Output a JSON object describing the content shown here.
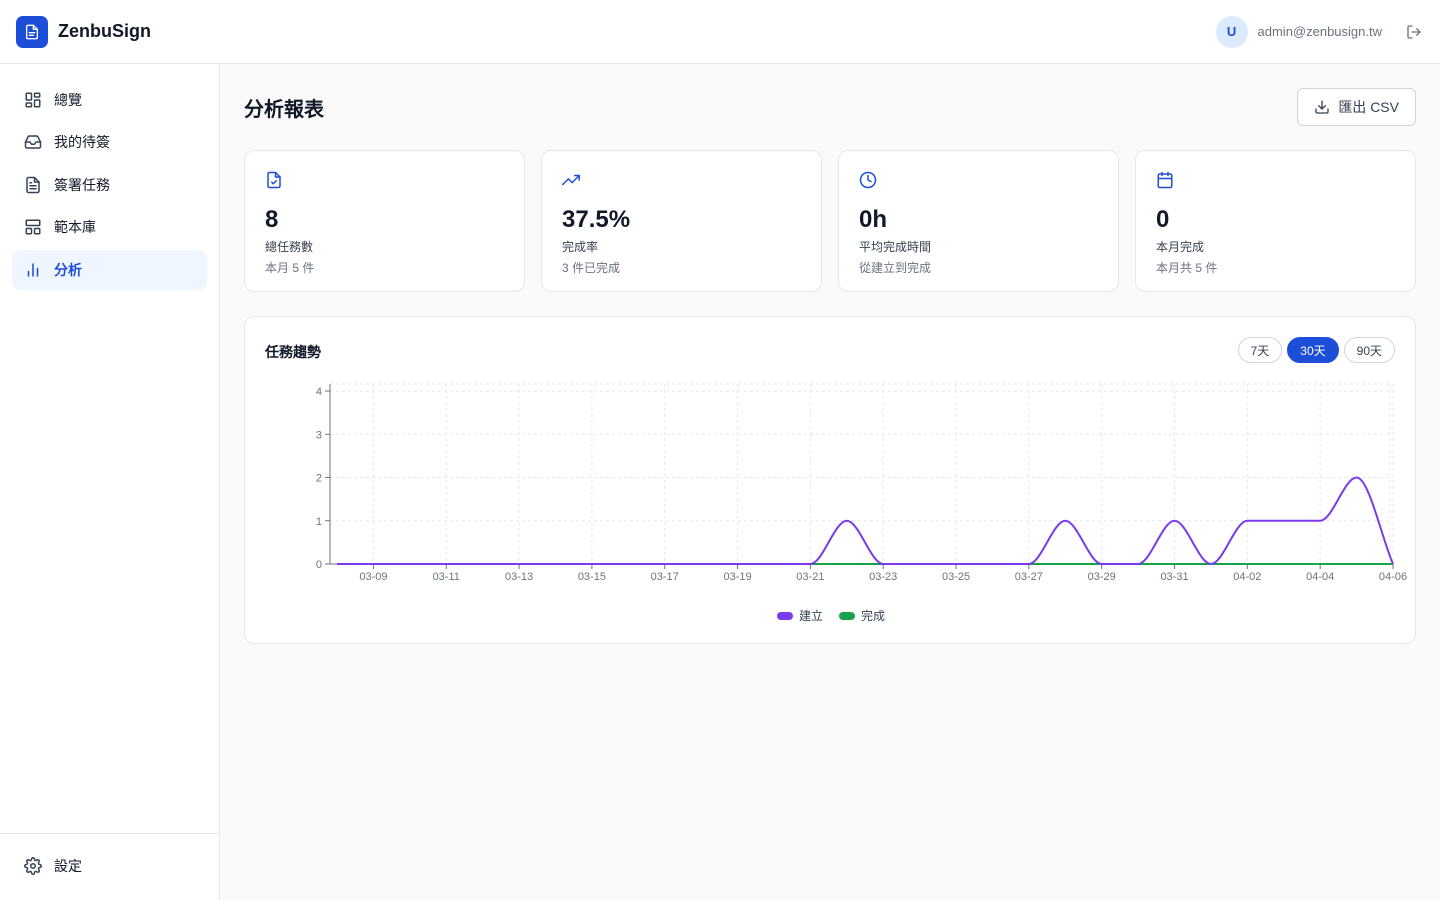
{
  "app": {
    "name": "ZenbuSign"
  },
  "user": {
    "initial": "U",
    "email": "admin@zenbusign.tw"
  },
  "sidebar": {
    "items": [
      {
        "label": "總覽",
        "icon": "grid-icon"
      },
      {
        "label": "我的待簽",
        "icon": "inbox-icon"
      },
      {
        "label": "簽署任務",
        "icon": "document-icon"
      },
      {
        "label": "範本庫",
        "icon": "template-icon"
      },
      {
        "label": "分析",
        "icon": "bar-chart-icon",
        "active": true
      }
    ],
    "settings_label": "設定"
  },
  "page": {
    "title": "分析報表",
    "export_label": "匯出 CSV"
  },
  "stats": [
    {
      "icon": "file-check-icon",
      "value": "8",
      "label": "總任務數",
      "sub": "本月 5 件"
    },
    {
      "icon": "trending-up-icon",
      "value": "37.5%",
      "label": "完成率",
      "sub": "3 件已完成"
    },
    {
      "icon": "clock-icon",
      "value": "0h",
      "label": "平均完成時間",
      "sub": "從建立到完成"
    },
    {
      "icon": "calendar-icon",
      "value": "0",
      "label": "本月完成",
      "sub": "本月共 5 件"
    }
  ],
  "chart": {
    "title": "任務趨勢",
    "ranges": [
      {
        "label": "7天"
      },
      {
        "label": "30天",
        "active": true
      },
      {
        "label": "90天"
      }
    ]
  },
  "colors": {
    "accent": "#1d4ed8",
    "created": "#7c3aed",
    "completed": "#16a34a"
  },
  "chart_data": {
    "type": "line",
    "x": [
      "03-08",
      "03-09",
      "03-10",
      "03-11",
      "03-12",
      "03-13",
      "03-14",
      "03-15",
      "03-16",
      "03-17",
      "03-18",
      "03-19",
      "03-20",
      "03-21",
      "03-22",
      "03-23",
      "03-24",
      "03-25",
      "03-26",
      "03-27",
      "03-28",
      "03-29",
      "03-30",
      "03-31",
      "04-01",
      "04-02",
      "04-03",
      "04-04",
      "04-05",
      "04-06"
    ],
    "x_ticks": [
      "03-09",
      "03-11",
      "03-13",
      "03-15",
      "03-17",
      "03-19",
      "03-21",
      "03-23",
      "03-25",
      "03-27",
      "03-29",
      "03-31",
      "04-02",
      "04-04",
      "04-06"
    ],
    "series": [
      {
        "name": "建立",
        "values": [
          0,
          0,
          0,
          0,
          0,
          0,
          0,
          0,
          0,
          0,
          0,
          0,
          0,
          0,
          1,
          0,
          0,
          0,
          0,
          0,
          1,
          0,
          0,
          1,
          0,
          1,
          1,
          1,
          2,
          0
        ]
      },
      {
        "name": "完成",
        "values": [
          0,
          0,
          0,
          0,
          0,
          0,
          0,
          0,
          0,
          0,
          0,
          0,
          0,
          0,
          0,
          0,
          0,
          0,
          0,
          0,
          0,
          0,
          0,
          0,
          0,
          0,
          0,
          0,
          0,
          0
        ]
      }
    ],
    "ylim": [
      0,
      4
    ],
    "y_ticks": [
      0,
      1,
      2,
      3,
      4
    ],
    "grid": true,
    "legend": "bottom-center"
  }
}
